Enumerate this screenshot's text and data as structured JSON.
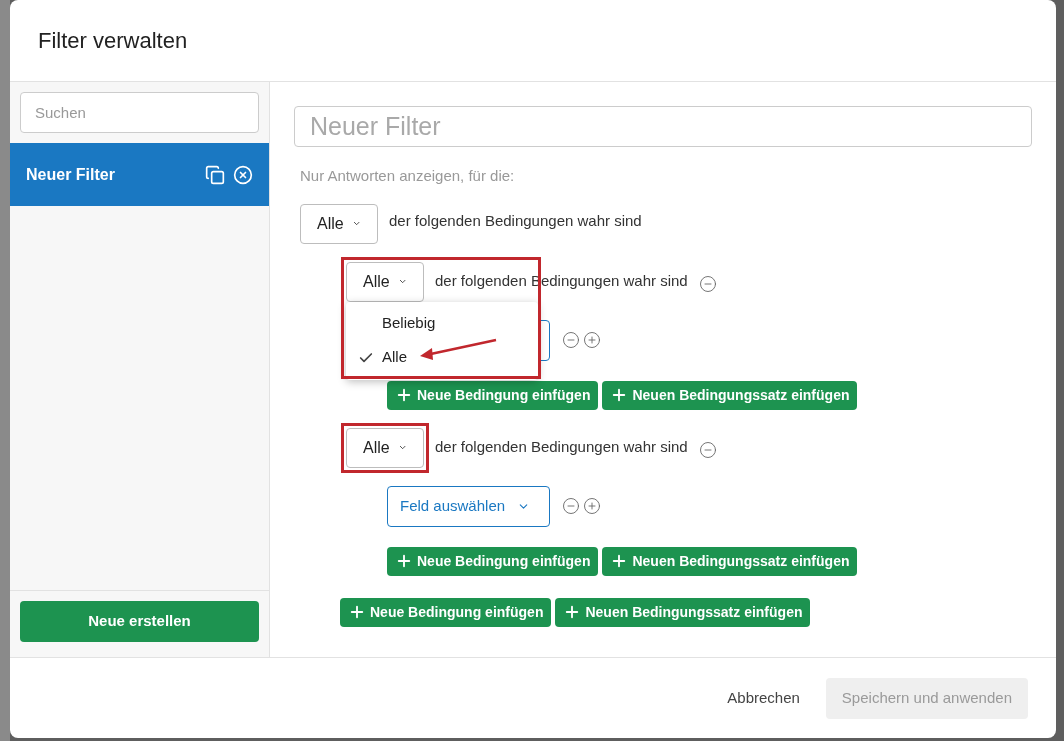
{
  "dialog": {
    "title": "Filter verwalten"
  },
  "sidebar": {
    "search": {
      "placeholder": "Suchen"
    },
    "filters": [
      {
        "name": "Neuer Filter",
        "selected": true
      }
    ],
    "create_button": "Neue erstellen"
  },
  "editor": {
    "name": {
      "placeholder": "Neuer Filter"
    },
    "intro": "Nur Antworten anzeigen, für die:",
    "match": "Alle",
    "match_text": "der folgenden Bedingungen wahr sind",
    "groups": [
      {
        "match": "Alle",
        "match_text": "der folgenden Bedingungen wahr sind",
        "highlighted": true,
        "menu": {
          "options": [
            {
              "label": "Beliebig",
              "selected": false
            },
            {
              "label": "Alle",
              "selected": true
            }
          ]
        },
        "add_condition": "Neue Bedingung einfügen",
        "add_set": "Neuen Bedingungssatz einfügen"
      },
      {
        "match": "Alle",
        "match_text": "der folgenden Bedingungen wahr sind",
        "highlighted": true,
        "field": "Feld auswählen",
        "add_condition": "Neue Bedingung einfügen",
        "add_set": "Neuen Bedingungssatz einfügen"
      }
    ],
    "add_condition": "Neue Bedingung einfügen",
    "add_set": "Neuen Bedingungssatz einfügen"
  },
  "footer": {
    "cancel": "Abbrechen",
    "save": {
      "label": "Speichern und anwenden",
      "disabled": true
    }
  }
}
